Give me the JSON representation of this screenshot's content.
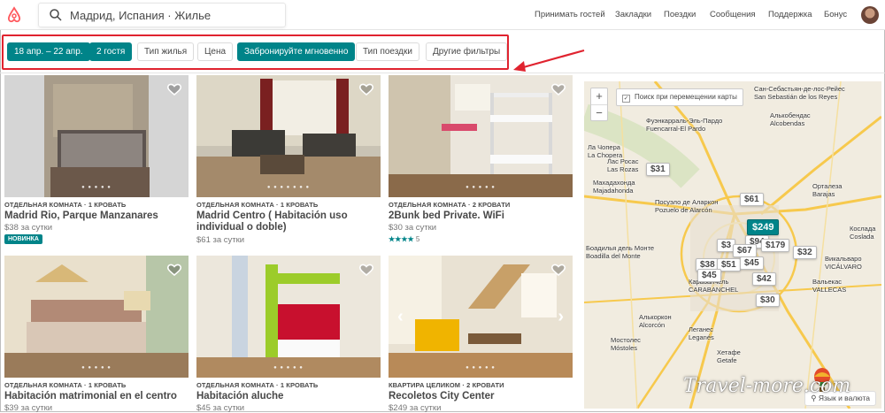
{
  "header": {
    "search_text": "Мадрид, Испания · Жилье",
    "nav": [
      "Принимать гостей",
      "Закладки",
      "Поездки",
      "Сообщения",
      "Поддержка",
      "Бонус"
    ]
  },
  "filters": {
    "dates": "18 апр. – 22 апр.",
    "guests": "2 гостя",
    "home_type": "Тип жилья",
    "price": "Цена",
    "instant_book": "Забронируйте мгновенно",
    "trip_type": "Тип поездки",
    "more": "Другие фильтры"
  },
  "listings": [
    {
      "meta": "ОТДЕЛЬНАЯ КОМНАТА · 1 КРОВАТЬ",
      "title": "Madrid Rio, Parque Manzanares",
      "price": "$38",
      "per": "за сутки",
      "badge": "НОВИНКА"
    },
    {
      "meta": "ОТДЕЛЬНАЯ КОМНАТА · 1 КРОВАТЬ",
      "title": "Madrid Centro ( Habitación uso individual o doble)",
      "price": "$61",
      "per": "за сутки"
    },
    {
      "meta": "ОТДЕЛЬНАЯ КОМНАТА · 2 КРОВАТИ",
      "title": "2Bunk bed Private. WiFi",
      "price": "$30",
      "per": "за сутки",
      "stars": "★★★★",
      "reviews": "5"
    },
    {
      "meta": "ОТДЕЛЬНАЯ КОМНАТА · 1 КРОВАТЬ",
      "title": "Habitación matrimonial en el centro",
      "price": "$39",
      "per": "за сутки"
    },
    {
      "meta": "ОТДЕЛЬНАЯ КОМНАТА · 1 КРОВАТЬ",
      "title": "Habitación aluche",
      "price": "$45",
      "per": "за сутки"
    },
    {
      "meta": "КВАРТИРА ЦЕЛИКОМ · 2 КРОВАТИ",
      "title": "Recoletos City Center",
      "price": "$249",
      "per": "за сутки"
    }
  ],
  "map": {
    "zoom_in": "+",
    "zoom_out": "−",
    "search_on_move": "Поиск при перемещении карты",
    "language": "Язык и валюта",
    "places": [
      "Сан-Себастьян-де-лос-Рейес",
      "San Sebastián de los Reyes",
      "Алькобендас",
      "Alcobendas",
      "Фуэнкарраль-Эль-Пардо",
      "Fuencarral-El Pardo",
      "Лас Росас",
      "Las Rozas",
      "Мaxaдaxoндa",
      "Majadahonda",
      "Посуэло де Аларкон",
      "Pozuelo de Alarcón",
      "Ортaлеза",
      "Barajas",
      "Коcлада",
      "Coslada",
      "Лa Чопера",
      "La Chopera",
      "Бoaдилья дель Монте",
      "Boadilla del Monte",
      "Карабанчель",
      "CARABANCHEL",
      "Алькоркон",
      "Alcorcón",
      "Леганес",
      "Leganés",
      "Мостолес",
      "Móstoles",
      "Хетафе",
      "Getafe",
      "Викальваро",
      "VICÁLVARO",
      "Вальекас",
      "VALLECAS"
    ],
    "pins": [
      "$31",
      "$61",
      "$249",
      "$3",
      "$94",
      "$67",
      "$179",
      "$32",
      "$38",
      "$51",
      "$45",
      "$45",
      "$42",
      "$30"
    ]
  },
  "watermark": "Travel-more.com",
  "colors": {
    "teal": "#008489",
    "brand": "#ff5a5f",
    "highlight": "#e0232f"
  }
}
